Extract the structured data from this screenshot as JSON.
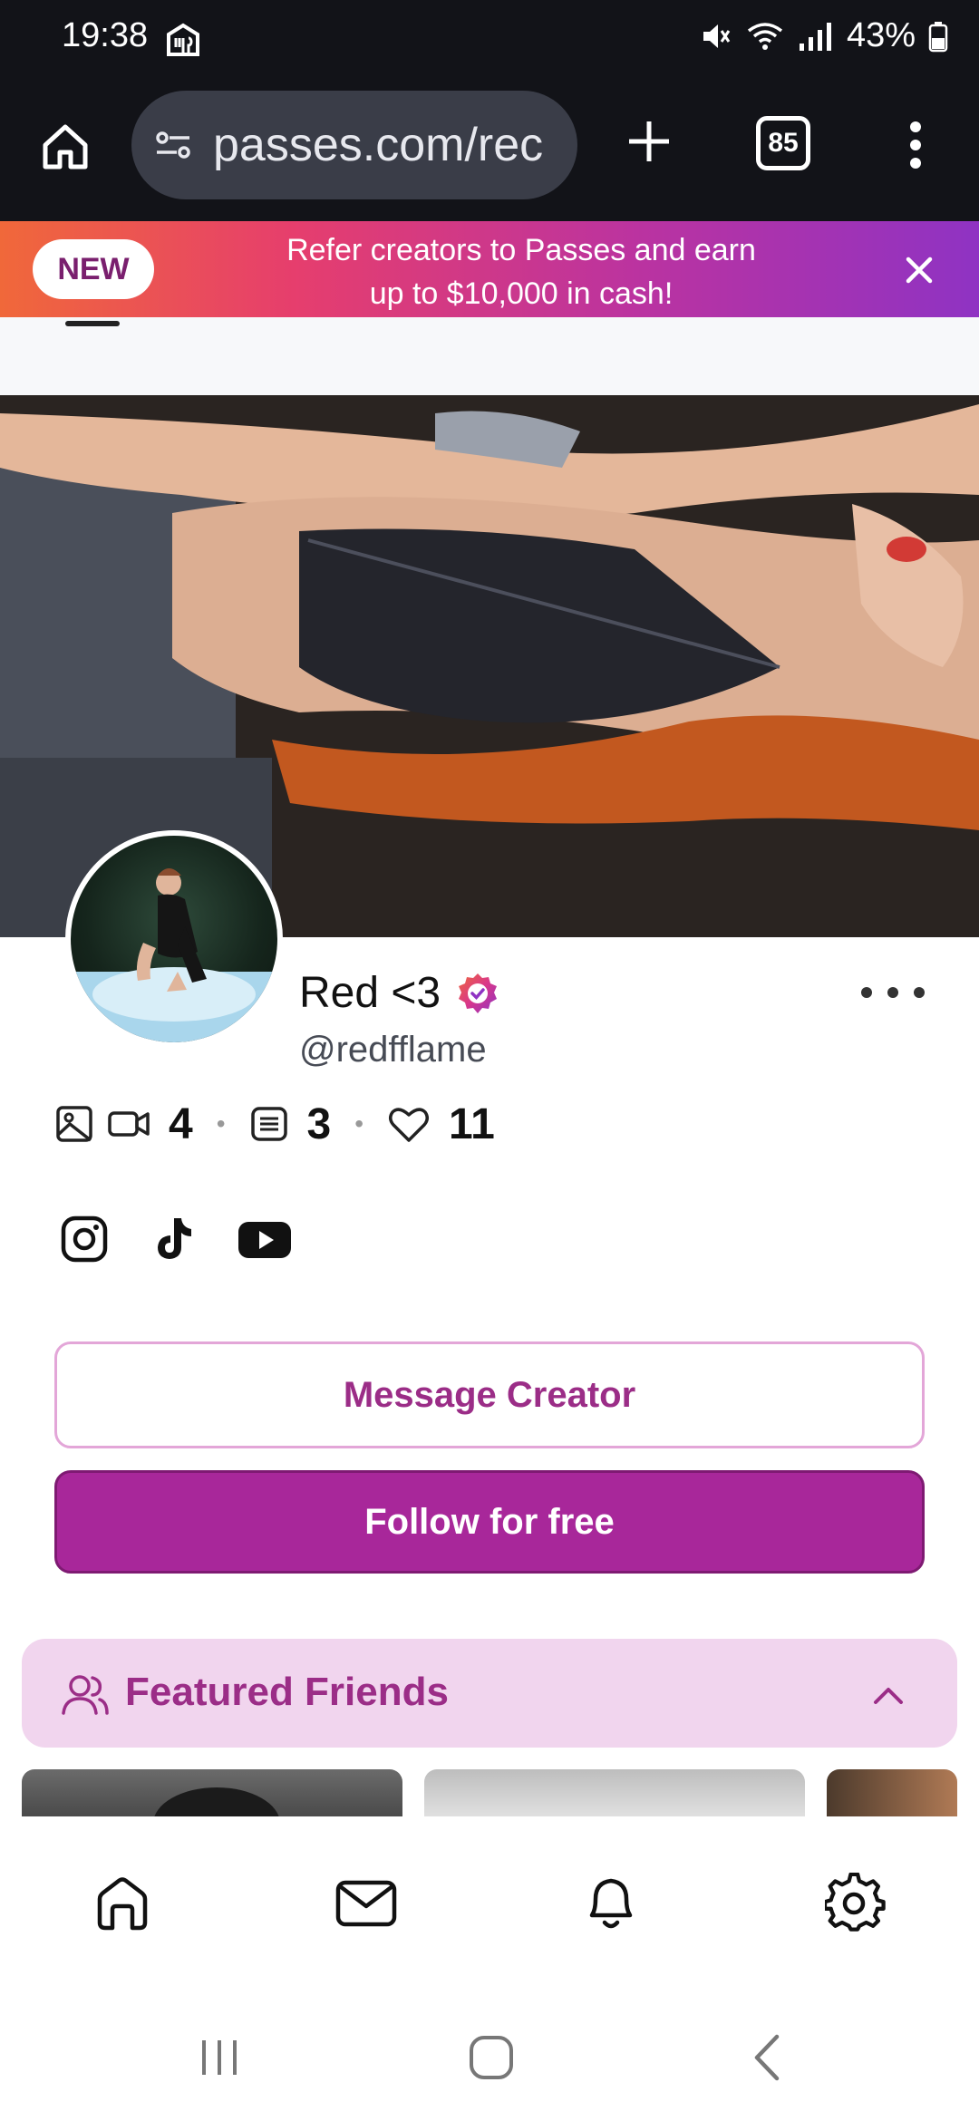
{
  "status_bar": {
    "time": "19:38",
    "battery": "43%",
    "icons": [
      "app-notification-icon",
      "mute-icon",
      "wifi-icon",
      "signal-icon",
      "battery-icon"
    ]
  },
  "browser": {
    "url": "passes.com/rec",
    "tab_count": "85",
    "icons": [
      "home-icon",
      "site-settings-icon",
      "plus-icon",
      "more-vertical-icon"
    ]
  },
  "promo_banner": {
    "badge": "NEW",
    "text_line1": "Refer creators to Passes and earn",
    "text_line2": "up to $10,000 in cash!",
    "close_icon": "close-icon"
  },
  "profile": {
    "name": "Red <3",
    "handle": "@redfflame",
    "verified": true,
    "stats": {
      "media": "4",
      "posts": "3",
      "likes": "11"
    },
    "socials": [
      "instagram-icon",
      "tiktok-icon",
      "youtube-icon"
    ]
  },
  "actions": {
    "message_label": "Message Creator",
    "follow_label": "Follow for free"
  },
  "featured": {
    "title": "Featured Friends",
    "expanded": true
  },
  "bottom_nav": [
    "home-icon",
    "mail-icon",
    "bell-icon",
    "settings-icon"
  ],
  "system_nav": [
    "recents-icon",
    "home-circle-icon",
    "back-icon"
  ],
  "colors": {
    "accent": "#a8279a",
    "accent_text": "#9b2d87",
    "featured_bg": "#f1d5ee",
    "status_bg": "#121318"
  }
}
